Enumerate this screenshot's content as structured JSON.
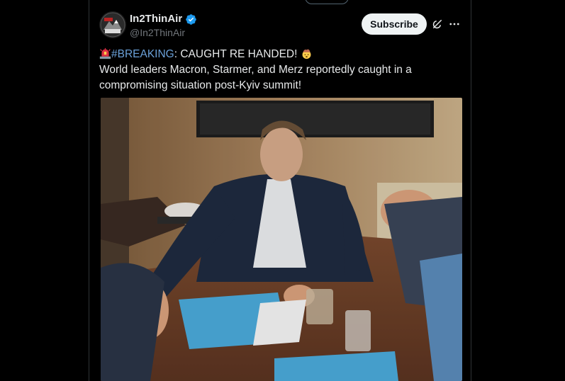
{
  "post": {
    "author": {
      "display_name": "In2ThinAir",
      "handle": "@In2ThinAir",
      "verified": true,
      "avatar_text": "THIN AIR"
    },
    "actions": {
      "subscribe_label": "Subscribe"
    },
    "text": {
      "line1_hashtag": "#BREAKING",
      "line1_rest": ": CAUGHT RE HANDED! ",
      "line2": " World leaders Macron, Starmer, and Merz reportedly caught in a",
      "line3": "compromising situation post-Kyiv summit!"
    },
    "media": {
      "type": "video",
      "description_icon": "video-still"
    }
  },
  "colors": {
    "background": "#000000",
    "text_primary": "#e7e9ea",
    "text_secondary": "#71767b",
    "hashtag": "#6aa0d8",
    "verified": "#1d9bf0",
    "subscribe_bg": "#eff3f4",
    "border": "#2f3336"
  }
}
